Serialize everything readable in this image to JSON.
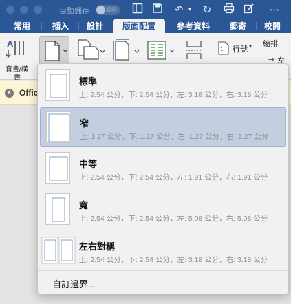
{
  "titlebar": {
    "autosave_label": "自動儲存",
    "autosave_toggle": "關閉"
  },
  "tabs": [
    {
      "label": "常用"
    },
    {
      "label": "插入"
    },
    {
      "label": "設計"
    },
    {
      "label": "版面配置"
    },
    {
      "label": "參考資料"
    },
    {
      "label": "郵寄"
    },
    {
      "label": "校閱"
    }
  ],
  "ribbon": {
    "text_direction_label_1": "直書/橫",
    "text_direction_label_2": "書",
    "line_numbers_label": "行號",
    "indent_label": "縮排",
    "left_label": "左"
  },
  "message_bar": {
    "text": "Offic"
  },
  "margins_menu": {
    "presets": [
      {
        "title": "標準",
        "detail": "上: 2.54 公分，下: 2.54 公分，左: 3.18 公分，右: 3.18 公分"
      },
      {
        "title": "窄",
        "detail": "上: 1.27 公分，下: 1.27 公分，左: 1.27 公分，右: 1.27 公分"
      },
      {
        "title": "中等",
        "detail": "上: 2.54 公分，下: 2.54 公分，左: 1.91 公分，右: 1.91 公分"
      },
      {
        "title": "寬",
        "detail": "上: 2.54 公分，下: 2.54 公分，左: 5.08 公分，右: 5.08 公分"
      },
      {
        "title": "左右對稱",
        "detail": "上: 2.54 公分，下: 2.54 公分，左: 3.18 公分，右: 3.18 公分"
      }
    ],
    "selected_title": "窄",
    "custom_label": "自訂邊界..."
  },
  "colors": {
    "title_blue": "#2b5797",
    "selected_bg": "#c3cfe0",
    "message_bg": "#fdf5d6"
  }
}
